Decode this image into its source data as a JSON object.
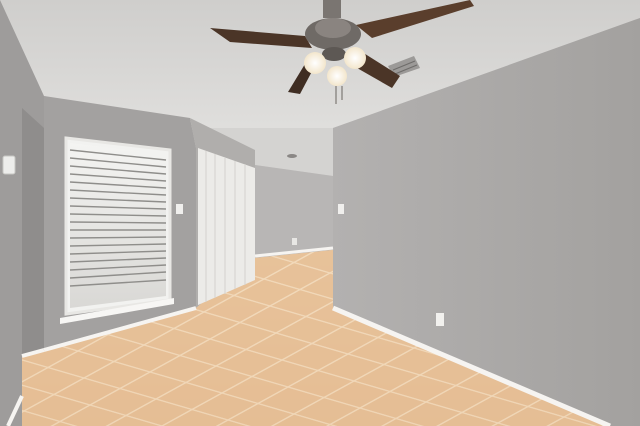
{
  "scene": {
    "kind": "photo",
    "subject": "empty room",
    "colors": {
      "ceiling": "#dad9d7",
      "wall_right": "#a9a7a6",
      "wall_left": "#9b9998",
      "wall_back": "#b8b6b5",
      "floor_tile": "#e4bc93",
      "grout": "#f0d6b6",
      "baseboard": "#f4f2ef",
      "fan_blade": "#4a3426",
      "fan_metal": "#6f6a66",
      "light": "#fff6e6",
      "blind": "#efefed"
    },
    "icons": [
      "ceiling-fan-icon",
      "window-blinds-icon",
      "thermostat-icon",
      "light-switch-icon",
      "wall-outlet-icon",
      "air-vent-icon"
    ]
  }
}
